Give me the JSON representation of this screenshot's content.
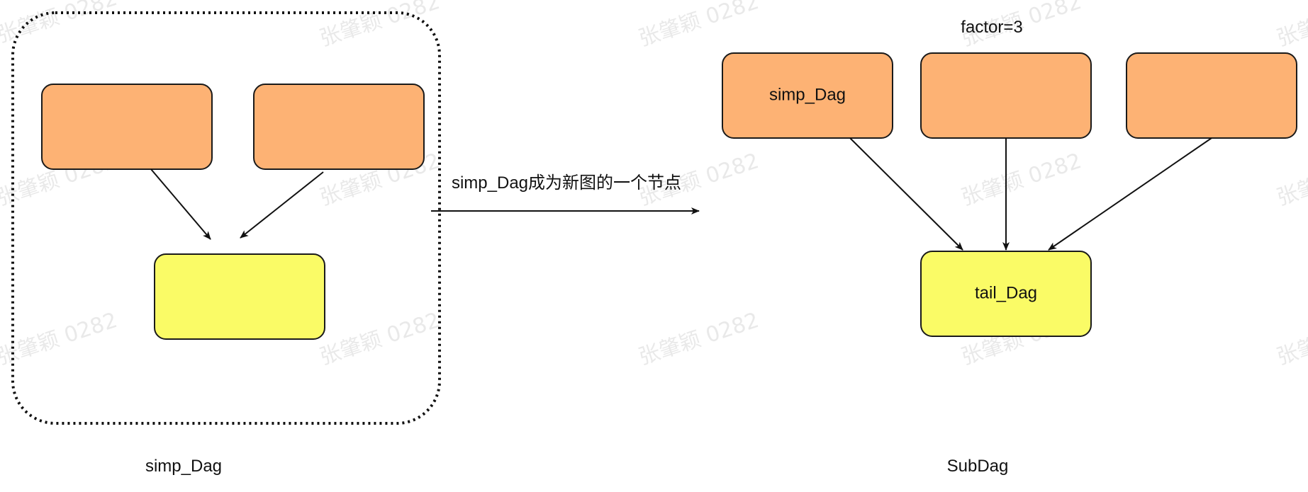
{
  "colors": {
    "orange_node": "#fdb274",
    "yellow_node": "#fafb66",
    "edge": "#111111",
    "group_border": "#111111"
  },
  "watermark": {
    "text": "张肇颖 0282"
  },
  "left_panel": {
    "caption": "simp_Dag",
    "nodes": [
      {
        "label": ""
      },
      {
        "label": ""
      },
      {
        "label": ""
      }
    ]
  },
  "transition": {
    "label": "simp_Dag成为新图的一个节点"
  },
  "right_panel": {
    "factor_label": "factor=3",
    "caption": "SubDag",
    "nodes": [
      {
        "label": "simp_Dag"
      },
      {
        "label": ""
      },
      {
        "label": ""
      },
      {
        "label": "tail_Dag"
      }
    ]
  }
}
